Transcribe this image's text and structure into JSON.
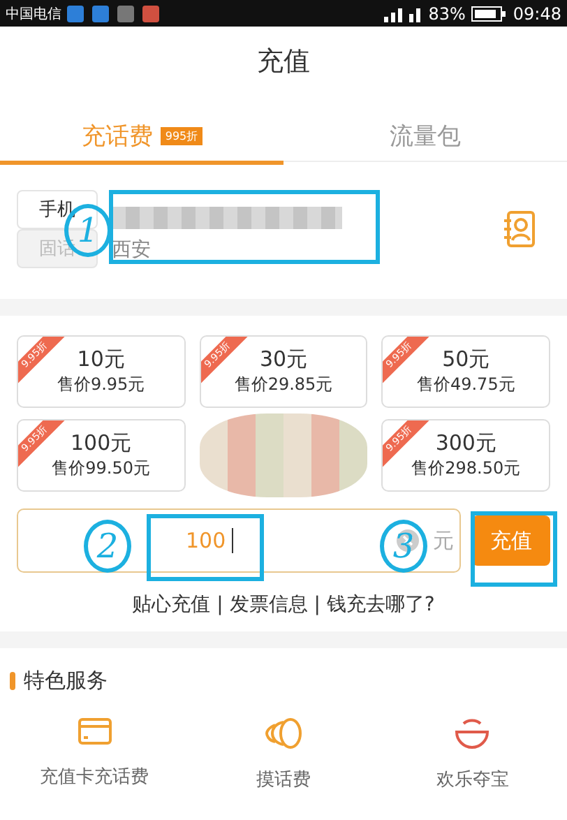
{
  "status_bar": {
    "carrier": "中国电信",
    "battery": "83%",
    "time": "09:48"
  },
  "title": "充值",
  "tabs": [
    {
      "label": "充话费",
      "badge": "995折",
      "selected": true
    },
    {
      "label": "流量包",
      "selected": false
    }
  ],
  "phone": {
    "types": [
      {
        "label": "手机",
        "selected": true
      },
      {
        "label": "固话",
        "selected": false
      }
    ],
    "location": "西安"
  },
  "packages": [
    {
      "discount": "9.95折",
      "amount": "10元",
      "price": "售价9.95元",
      "hidden": false
    },
    {
      "discount": "9.95折",
      "amount": "30元",
      "price": "售价29.85元",
      "hidden": false
    },
    {
      "discount": "9.95折",
      "amount": "50元",
      "price": "售价49.75元",
      "hidden": false
    },
    {
      "discount": "9.95折",
      "amount": "100元",
      "price": "售价99.50元",
      "hidden": false
    },
    {
      "hidden": true
    },
    {
      "discount": "9.95折",
      "amount": "300元",
      "price": "售价298.50元",
      "hidden": false
    }
  ],
  "custom_amount": {
    "value": "100",
    "unit": "元",
    "button": "充值"
  },
  "links": "贴心充值 | 发票信息 | 钱充去哪了?",
  "services": {
    "title": "特色服务",
    "items": [
      {
        "kind": "card",
        "label": "充值卡充话费"
      },
      {
        "kind": "coins",
        "label": "摸话费"
      },
      {
        "kind": "bowl",
        "label": "欢乐夺宝"
      }
    ]
  },
  "annotations": [
    "1",
    "2",
    "3"
  ]
}
